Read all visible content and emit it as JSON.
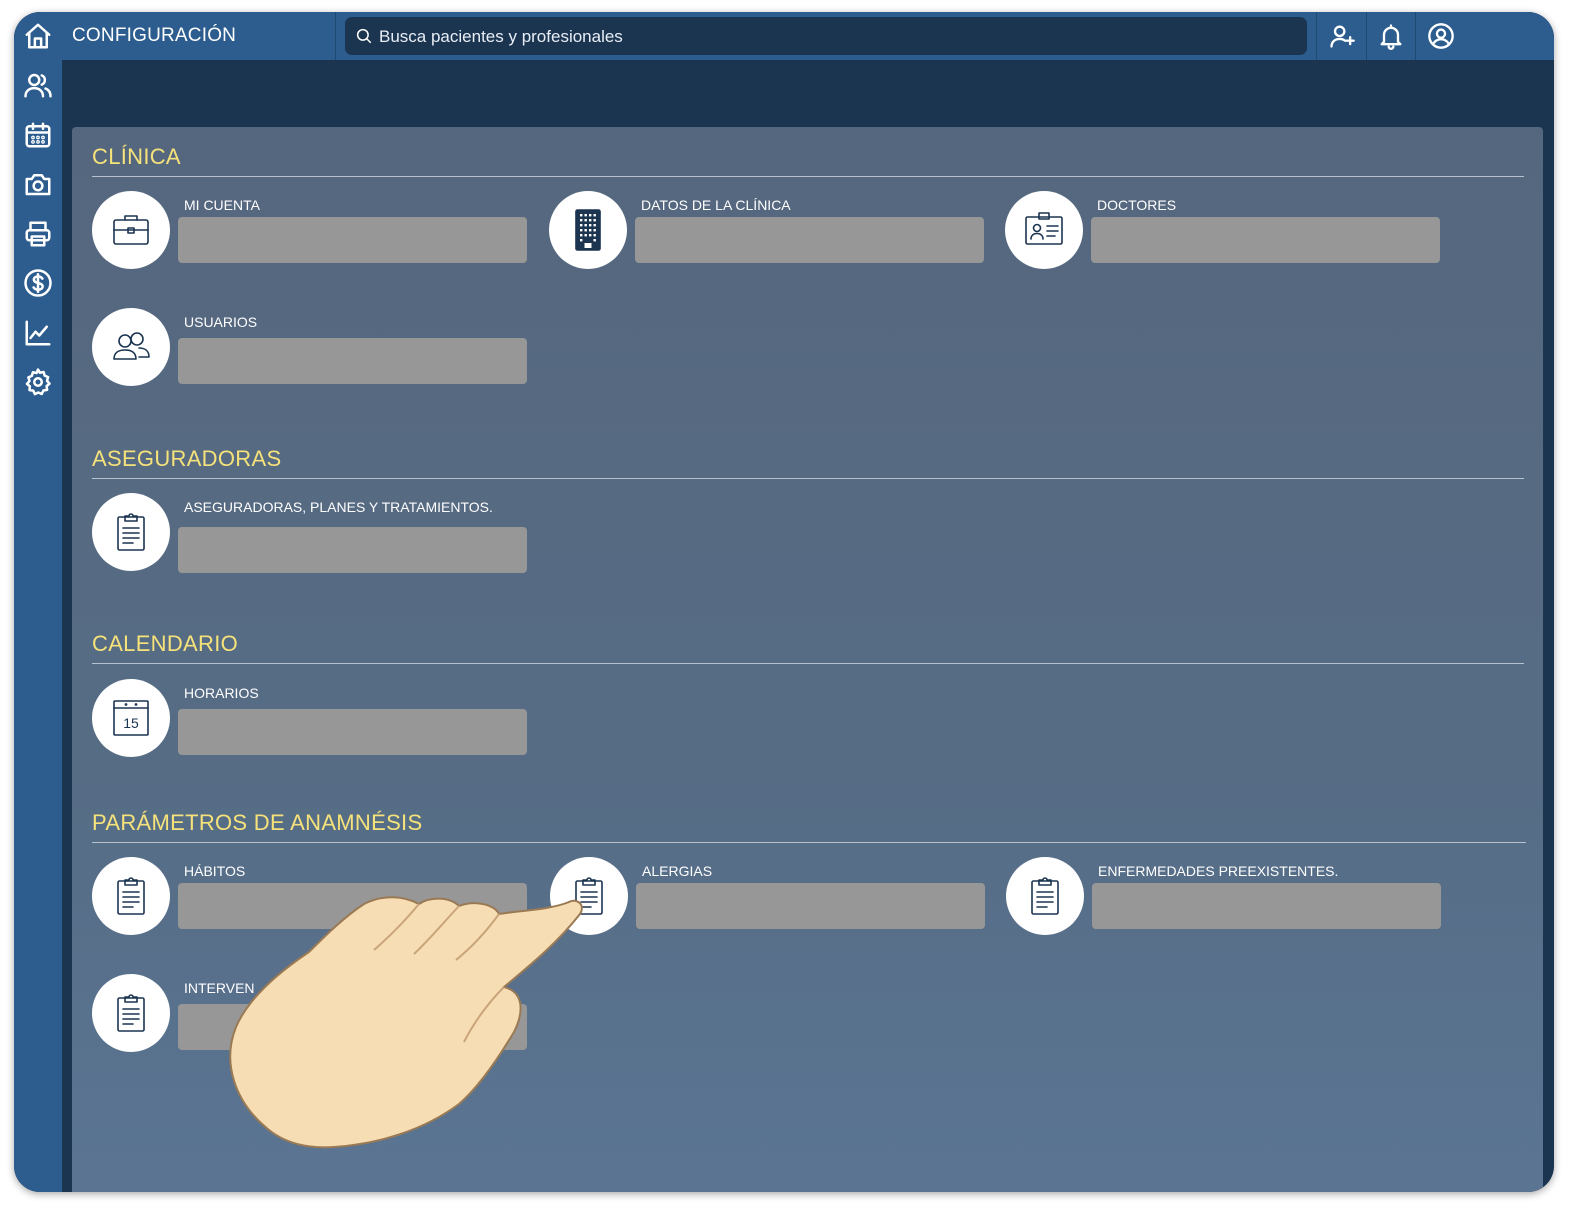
{
  "header": {
    "title": "CONFIGURACIÓN",
    "search_placeholder": "Busca pacientes y profesionales"
  },
  "sidebar": {
    "items": [
      "home-icon",
      "users-icon",
      "calendar-icon",
      "camera-icon",
      "printer-icon",
      "dollar-icon",
      "chart-icon",
      "gear-icon"
    ]
  },
  "topbar_icons": [
    "add-user-icon",
    "bell-icon",
    "user-circle-icon"
  ],
  "colors": {
    "sidebar": "#2c5d8e",
    "background": "#1b3450",
    "section_title": "#f6e27a",
    "placeholder_bar": "#979797"
  },
  "sections": {
    "clinica": {
      "title": "CLÍNICA",
      "items": [
        {
          "label": "MI CUENTA",
          "icon": "briefcase-icon"
        },
        {
          "label": "DATOS DE LA CLÍNICA",
          "icon": "building-icon"
        },
        {
          "label": "DOCTORES",
          "icon": "id-card-icon"
        },
        {
          "label": "USUARIOS",
          "icon": "users-icon"
        }
      ]
    },
    "aseguradoras": {
      "title": "ASEGURADORAS",
      "items": [
        {
          "label": "ASEGURADORAS, PLANES Y TRATAMIENTOS.",
          "icon": "clipboard-icon"
        }
      ]
    },
    "calendario": {
      "title": "CALENDARIO",
      "items": [
        {
          "label": "HORARIOS",
          "icon": "calendar-15-icon",
          "icon_text": "15"
        }
      ]
    },
    "anamnesis": {
      "title": "PARÁMETROS DE ANAMNÉSIS",
      "items": [
        {
          "label": "HÁBITOS",
          "icon": "clipboard-icon"
        },
        {
          "label": "ALERGIAS",
          "icon": "clipboard-icon"
        },
        {
          "label": "ENFERMEDADES PREEXISTENTES.",
          "icon": "clipboard-icon"
        },
        {
          "label": "INTERVEN",
          "icon": "clipboard-icon"
        }
      ]
    }
  },
  "overlay": {
    "icon": "pointing-hand-icon"
  }
}
